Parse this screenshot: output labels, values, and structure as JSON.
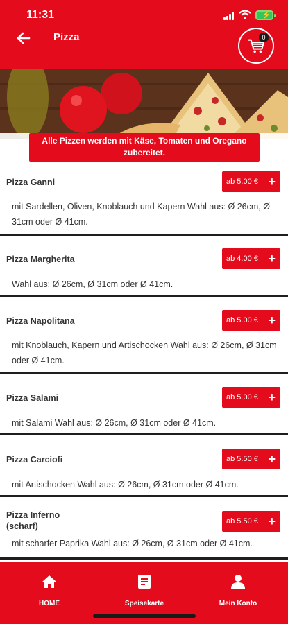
{
  "status_bar": {
    "time": "11:31"
  },
  "header": {
    "title": "Pizza",
    "cart_count": "0"
  },
  "hero": {
    "notice": "Alle Pizzen werden mit Käse, Tomaten und Oregano zubereitet."
  },
  "items": [
    {
      "name": "Pizza Ganni",
      "price": "ab 5.00 €",
      "description": "mit Sardellen, Oliven, Knoblauch und Kapern Wahl aus: Ø 26cm, Ø 31cm oder Ø 41cm."
    },
    {
      "name": "Pizza Margherita",
      "price": "ab 4.00 €",
      "description": "Wahl aus: Ø 26cm, Ø 31cm oder Ø 41cm."
    },
    {
      "name": "Pizza Napolitana",
      "price": "ab 5.00 €",
      "description": "mit Knoblauch, Kapern und Artischocken Wahl aus: Ø 26cm, Ø 31cm oder Ø 41cm."
    },
    {
      "name": "Pizza Salami",
      "price": "ab 5.00 €",
      "description": "mit Salami Wahl aus: Ø 26cm, Ø 31cm oder Ø 41cm."
    },
    {
      "name": "Pizza Carciofi",
      "price": "ab 5.50 €",
      "description": "mit Artischocken Wahl aus: Ø 26cm, Ø 31cm oder Ø 41cm."
    },
    {
      "name": "Pizza Inferno (scharf)",
      "price": "ab 5.50 €",
      "description": "mit scharfer Paprika Wahl aus: Ø 26cm, Ø 31cm oder Ø 41cm."
    }
  ],
  "bottom_nav": {
    "home": "HOME",
    "menu": "Speisekarte",
    "account": "Mein Konto"
  },
  "colors": {
    "brand_red": "#e30b1c",
    "text": "#333333",
    "divider": "#1e1e1e"
  }
}
